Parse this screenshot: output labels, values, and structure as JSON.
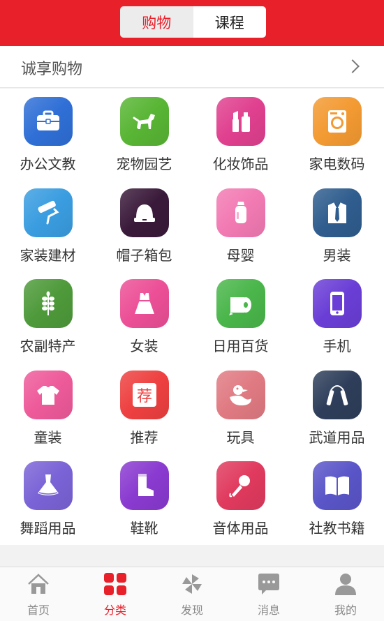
{
  "header": {
    "tabs": [
      {
        "label": "购物",
        "active": true
      },
      {
        "label": "课程",
        "active": false
      }
    ],
    "bg_color": "#e8202a"
  },
  "section": {
    "title": "诚享购物"
  },
  "categories": [
    {
      "label": "办公文教",
      "icon": "briefcase-icon",
      "color": "#2f6fd6"
    },
    {
      "label": "宠物园艺",
      "icon": "dog-icon",
      "color": "#58b534"
    },
    {
      "label": "化妆饰品",
      "icon": "cosmetics-icon",
      "color": "#e0408f"
    },
    {
      "label": "家电数码",
      "icon": "washing-machine-icon",
      "color": "#f39a32"
    },
    {
      "label": "家装建材",
      "icon": "paint-roller-icon",
      "color": "#3a9de0"
    },
    {
      "label": "帽子箱包",
      "icon": "hat-icon",
      "color": "#3a1a3a"
    },
    {
      "label": "母婴",
      "icon": "baby-bottle-icon",
      "color": "#f27ab3"
    },
    {
      "label": "男装",
      "icon": "suit-icon",
      "color": "#2f5d8e"
    },
    {
      "label": "农副特产",
      "icon": "wheat-icon",
      "color": "#4e9a3a"
    },
    {
      "label": "女装",
      "icon": "dress-icon",
      "color": "#ec4f96"
    },
    {
      "label": "日用百货",
      "icon": "tissue-roll-icon",
      "color": "#4ab64a"
    },
    {
      "label": "手机",
      "icon": "phone-icon",
      "color": "#6a3ed6"
    },
    {
      "label": "童装",
      "icon": "kids-shirt-icon",
      "color": "#ee5a9a"
    },
    {
      "label": "推荐",
      "icon": "recommend-icon",
      "color": "#ee4040"
    },
    {
      "label": "玩具",
      "icon": "duck-toy-icon",
      "color": "#e07a82"
    },
    {
      "label": "武道用品",
      "icon": "nunchaku-icon",
      "color": "#2e3e5a"
    },
    {
      "label": "舞蹈用品",
      "icon": "dance-dress-icon",
      "color": "#7a63d6"
    },
    {
      "label": "鞋靴",
      "icon": "boot-icon",
      "color": "#8a3ad0"
    },
    {
      "label": "音体用品",
      "icon": "microphone-icon",
      "color": "#e03a5e"
    },
    {
      "label": "社教书籍",
      "icon": "book-icon",
      "color": "#5a55c8"
    }
  ],
  "recommend_glyph": "荐",
  "tabbar": {
    "items": [
      {
        "label": "首页",
        "icon": "home-icon",
        "active": false
      },
      {
        "label": "分类",
        "icon": "category-icon",
        "active": true
      },
      {
        "label": "发现",
        "icon": "pinwheel-icon",
        "active": false
      },
      {
        "label": "消息",
        "icon": "message-icon",
        "active": false
      },
      {
        "label": "我的",
        "icon": "profile-icon",
        "active": false
      }
    ]
  }
}
